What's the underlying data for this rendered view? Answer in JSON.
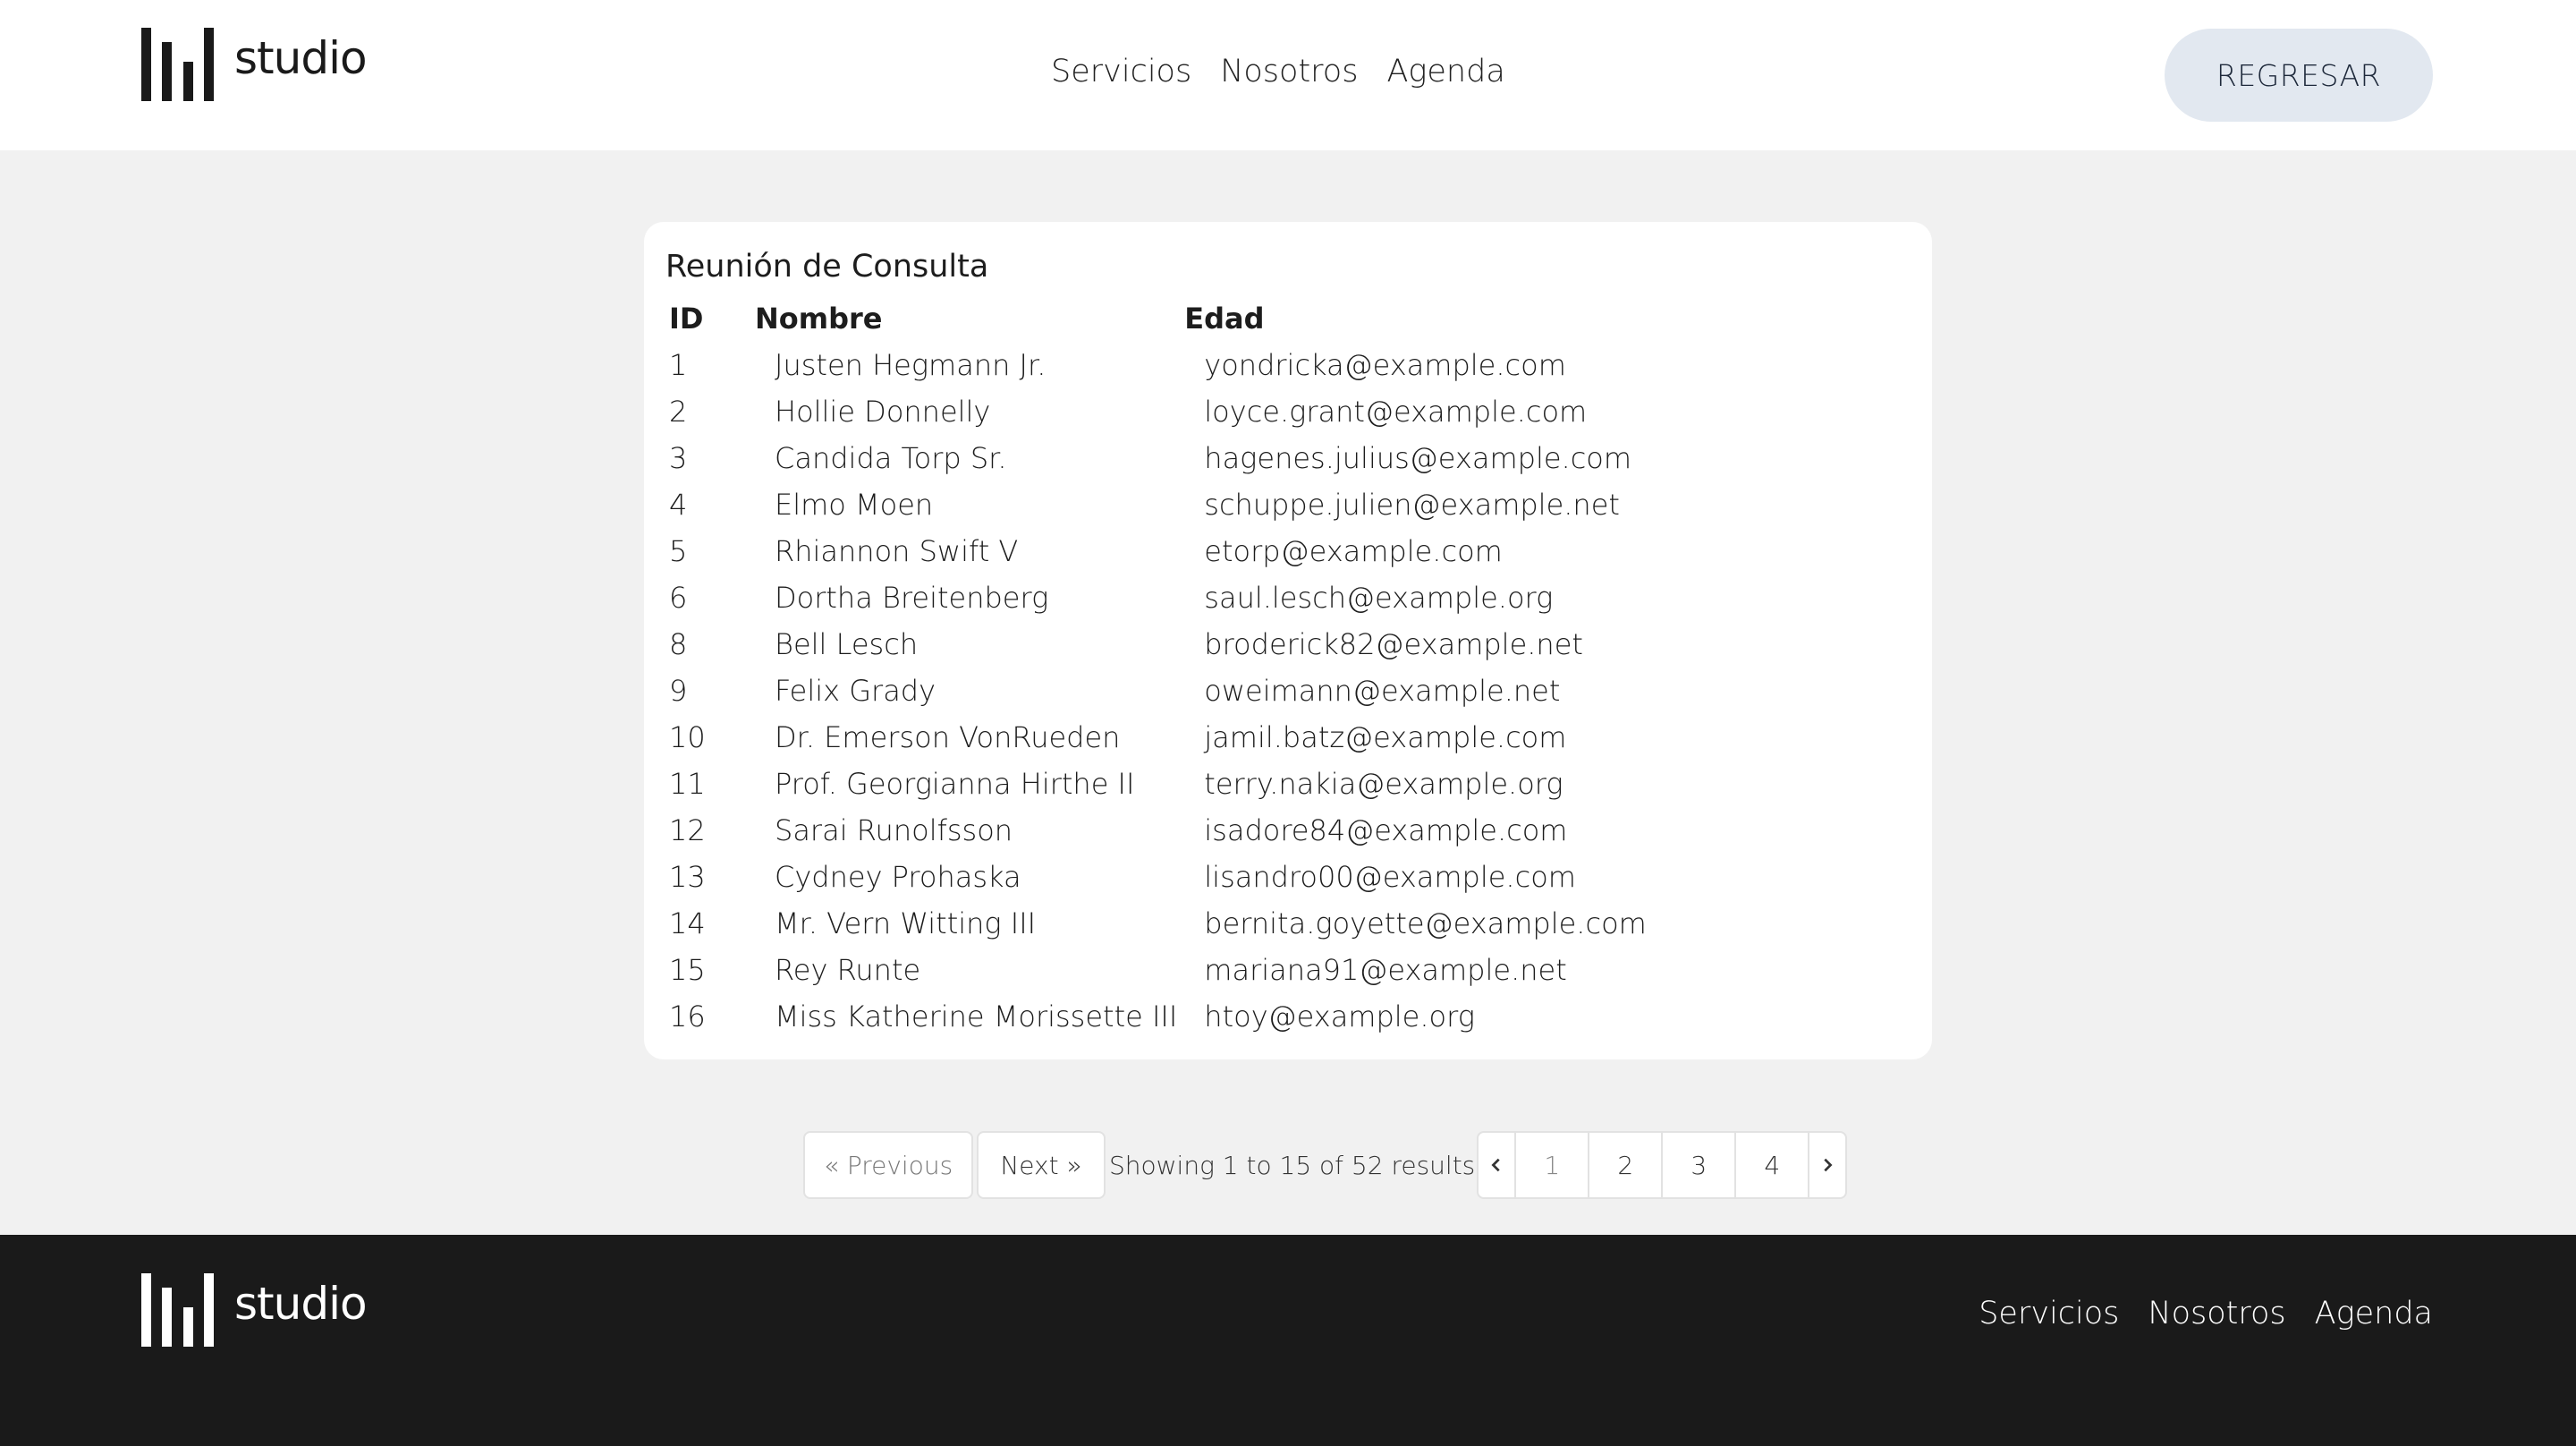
{
  "brand": {
    "name": "studio"
  },
  "header": {
    "nav": [
      "Servicios",
      "Nosotros",
      "Agenda"
    ],
    "back_label": "REGRESAR"
  },
  "table": {
    "title": "Reunión de Consulta",
    "columns": [
      "ID",
      "Nombre",
      "Edad"
    ],
    "rows": [
      {
        "id": "1",
        "name": "Justen Hegmann Jr.",
        "email": "yondricka@example.com"
      },
      {
        "id": "2",
        "name": "Hollie Donnelly",
        "email": "loyce.grant@example.com"
      },
      {
        "id": "3",
        "name": "Candida Torp Sr.",
        "email": "hagenes.julius@example.com"
      },
      {
        "id": "4",
        "name": "Elmo Moen",
        "email": "schuppe.julien@example.net"
      },
      {
        "id": "5",
        "name": "Rhiannon Swift V",
        "email": "etorp@example.com"
      },
      {
        "id": "6",
        "name": "Dortha Breitenberg",
        "email": "saul.lesch@example.org"
      },
      {
        "id": "8",
        "name": "Bell Lesch",
        "email": "broderick82@example.net"
      },
      {
        "id": "9",
        "name": "Felix Grady",
        "email": "oweimann@example.net"
      },
      {
        "id": "10",
        "name": "Dr. Emerson VonRueden",
        "email": "jamil.batz@example.com"
      },
      {
        "id": "11",
        "name": "Prof. Georgianna Hirthe II",
        "email": "terry.nakia@example.org"
      },
      {
        "id": "12",
        "name": "Sarai Runolfsson",
        "email": "isadore84@example.com"
      },
      {
        "id": "13",
        "name": "Cydney Prohaska",
        "email": "lisandro00@example.com"
      },
      {
        "id": "14",
        "name": "Mr. Vern Witting III",
        "email": "bernita.goyette@example.com"
      },
      {
        "id": "15",
        "name": "Rey Runte",
        "email": "mariana91@example.net"
      },
      {
        "id": "16",
        "name": "Miss Katherine Morissette III",
        "email": "htoy@example.org"
      }
    ]
  },
  "pagination": {
    "previous_label": "« Previous",
    "next_label": "Next »",
    "summary": "Showing 1 to 15 of 52 results",
    "pages": [
      "1",
      "2",
      "3",
      "4"
    ],
    "current_page": "1"
  },
  "footer": {
    "nav": [
      "Servicios",
      "Nosotros",
      "Agenda"
    ]
  }
}
